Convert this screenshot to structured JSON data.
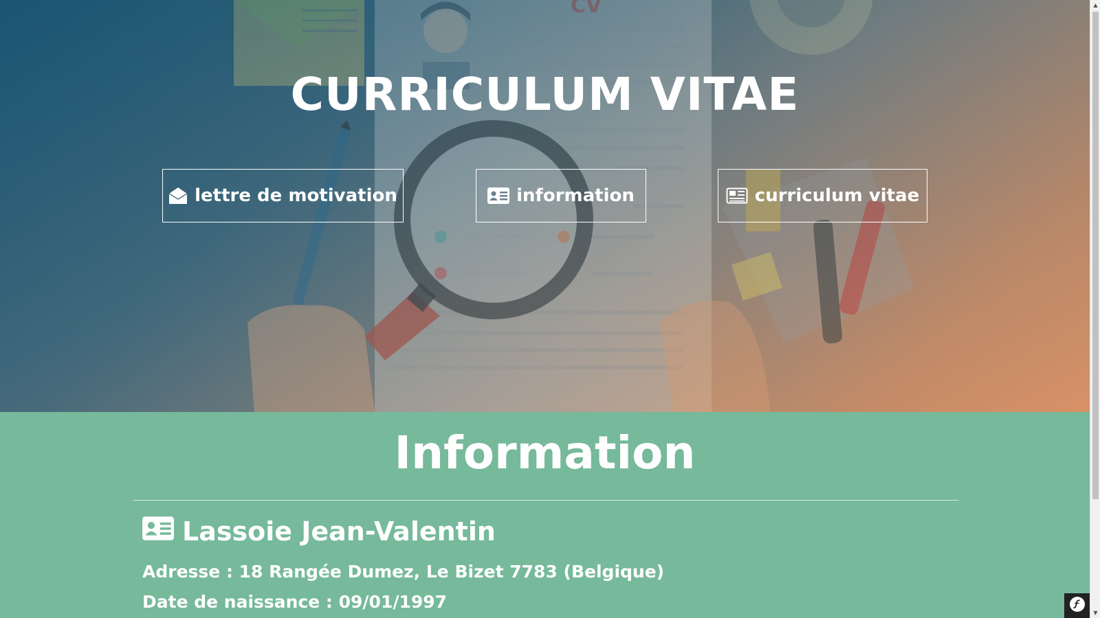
{
  "hero": {
    "title": "CURRICULUM VITAE",
    "background_colors": [
      "#1f5a78",
      "#d8946a"
    ],
    "nav": [
      {
        "label": "lettre de motivation",
        "icon": "envelope-open-icon"
      },
      {
        "label": "information",
        "icon": "id-card-icon"
      },
      {
        "label": "curriculum vitae",
        "icon": "newspaper-icon"
      }
    ]
  },
  "info": {
    "title": "Information",
    "background_color": "#76b99b",
    "name": "Lassoie Jean-Valentin",
    "name_icon": "id-card-icon",
    "adresse": "Adresse : 18 Rangée Dumez, Le Bizet 7783 (Belgique)",
    "naissance": "Date de naissance : 09/01/1997"
  },
  "toolbar": {
    "badge_icon": "symfony-icon"
  }
}
